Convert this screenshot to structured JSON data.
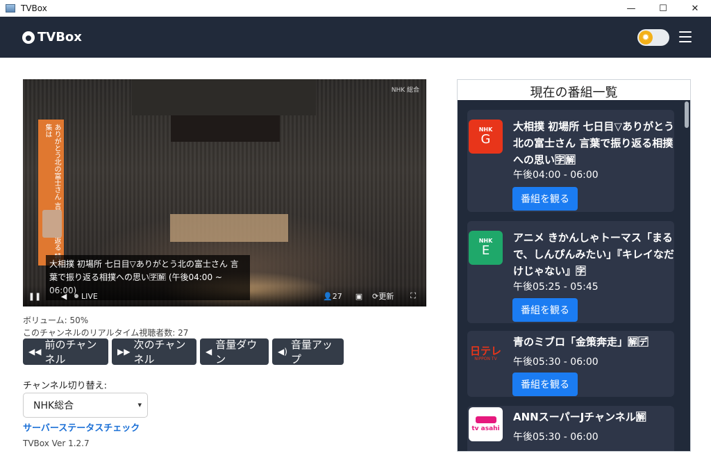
{
  "window": {
    "title": "TVBox",
    "minimize": "—",
    "maximize": "☐",
    "close": "✕"
  },
  "navbar": {
    "brand": "TVBox",
    "theme_toggle_icon": "sun-icon",
    "menu_icon": "hamburger-icon"
  },
  "player": {
    "caption": "大相撲 初場所 七日目▽ありがとう北の富士さん 言葉で振り返る相撲への思い🈑🈖 (午後04:00 ~ 06:00)",
    "banner_text": "ありがとう北の富士さん 言葉で振り返る 特集は",
    "watermark": "NHK 総合",
    "live_label": "LIVE",
    "viewers": "27",
    "refresh_label": "更新"
  },
  "status": {
    "volume": "ボリューム: 50%",
    "viewers": "このチャンネルのリアルタイム視聴者数: 27"
  },
  "buttons": {
    "prev_channel": "前のチャンネル",
    "next_channel": "次のチャンネル",
    "volume_down": "音量ダウン",
    "volume_up": "音量アップ"
  },
  "channel_switch": {
    "label": "チャンネル切り替え:",
    "selected": "NHK総合"
  },
  "server_status_link": "サーバーステータスチェック",
  "version": "TVBox Ver 1.2.7",
  "program_list": {
    "title": "現在の番組一覧",
    "watch_label": "番組を観る",
    "items": [
      {
        "channel_logo": "NHK G",
        "logo_color": "#e8351a",
        "title": "大相撲 初場所 七日目▽ありがとう北の富士さん 言葉で振り返る相撲への思い🈑🈖",
        "time": "午後04:00 - 06:00"
      },
      {
        "channel_logo": "NHK E",
        "logo_color": "#1fa86a",
        "title": "アニメ きかんしゃトーマス「まるで、しんぴんみたい」『キレイなだけじゃない』🈑",
        "time": "午後05:25 - 05:45"
      },
      {
        "channel_logo": "日テレ NIPPON TV",
        "logo_color": "#ffffff",
        "title": "青のミブロ「金策奔走」🈖🈓",
        "time": "午後05:30 - 06:00"
      },
      {
        "channel_logo": "tv asahi",
        "logo_color": "#ffffff",
        "title": "ANNスーパーJチャンネル🈖",
        "time": "午後05:30 - 06:00"
      }
    ]
  }
}
